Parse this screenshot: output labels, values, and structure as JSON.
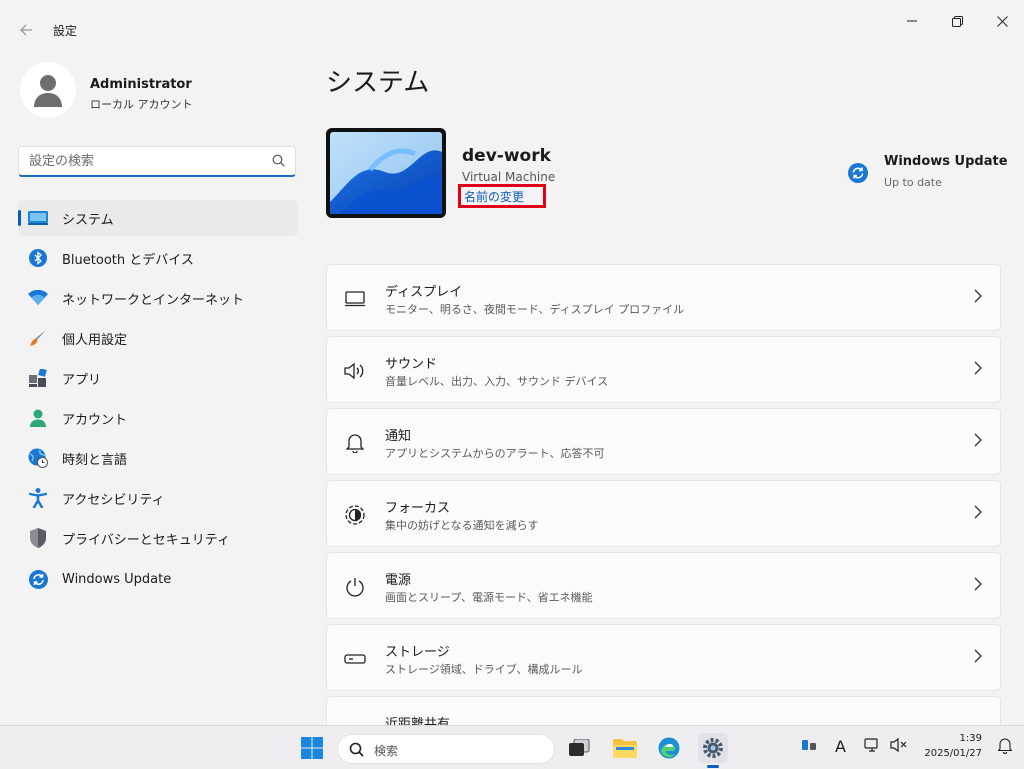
{
  "window": {
    "title": "設定"
  },
  "profile": {
    "name": "Administrator",
    "account_type": "ローカル アカウント"
  },
  "search": {
    "placeholder": "設定の検索"
  },
  "nav": {
    "items": [
      {
        "label": "システム",
        "icon": "system-icon",
        "active": true
      },
      {
        "label": "Bluetooth とデバイス",
        "icon": "bluetooth-icon"
      },
      {
        "label": "ネットワークとインターネット",
        "icon": "wifi-icon"
      },
      {
        "label": "個人用設定",
        "icon": "brush-icon"
      },
      {
        "label": "アプリ",
        "icon": "apps-icon"
      },
      {
        "label": "アカウント",
        "icon": "account-icon"
      },
      {
        "label": "時刻と言語",
        "icon": "time-language-icon"
      },
      {
        "label": "アクセシビリティ",
        "icon": "accessibility-icon"
      },
      {
        "label": "プライバシーとセキュリティ",
        "icon": "shield-icon"
      },
      {
        "label": "Windows Update",
        "icon": "windows-update-icon"
      }
    ]
  },
  "main": {
    "title": "システム",
    "device": {
      "name": "dev-work",
      "model": "Virtual Machine",
      "rename_label": "名前の変更"
    },
    "update": {
      "title": "Windows Update",
      "status": "Up to date"
    },
    "cards": [
      {
        "title": "ディスプレイ",
        "desc": "モニター、明るさ、夜間モード、ディスプレイ プロファイル",
        "icon": "display-icon"
      },
      {
        "title": "サウンド",
        "desc": "音量レベル、出力、入力、サウンド デバイス",
        "icon": "speaker-icon"
      },
      {
        "title": "通知",
        "desc": "アプリとシステムからのアラート、応答不可",
        "icon": "bell-icon"
      },
      {
        "title": "フォーカス",
        "desc": "集中の妨げとなる通知を減らす",
        "icon": "focus-icon"
      },
      {
        "title": "電源",
        "desc": "画面とスリープ、電源モード、省エネ機能",
        "icon": "power-icon"
      },
      {
        "title": "ストレージ",
        "desc": "ストレージ領域、ドライブ、構成ルール",
        "icon": "storage-icon"
      },
      {
        "title": "近距離共有",
        "desc": "",
        "icon": "nearby-share-icon"
      }
    ]
  },
  "taskbar": {
    "search_label": "検索",
    "ime": "A",
    "time": "1:39",
    "date": "2025/01/27"
  },
  "colors": {
    "accent": "#0a5cc0",
    "highlight_box": "#e0001a",
    "background": "#f3f3f3"
  }
}
